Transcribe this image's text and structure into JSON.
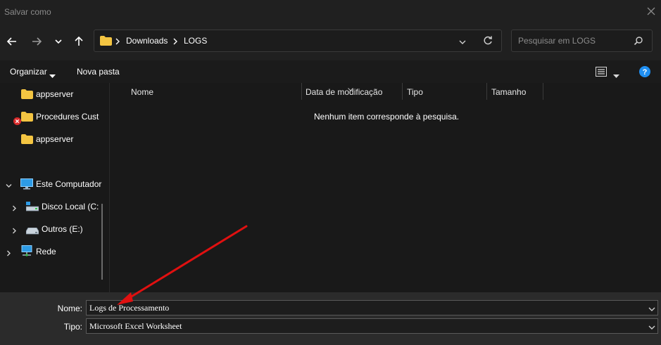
{
  "window": {
    "title": "Salvar como"
  },
  "address": {
    "crumbs": [
      "Downloads",
      "LOGS"
    ]
  },
  "search": {
    "placeholder": "Pesquisar em LOGS"
  },
  "toolbar": {
    "organize": "Organizar",
    "new_folder": "Nova pasta"
  },
  "sidebar": {
    "items": [
      {
        "label": "appserver",
        "icon": "folder-icon"
      },
      {
        "label": "Procedures Cust",
        "icon": "folder-icon"
      },
      {
        "label": "appserver",
        "icon": "folder-icon"
      },
      {
        "label": "Este Computador",
        "icon": "computer-icon"
      },
      {
        "label": "Disco Local (C:",
        "icon": "local-disk-icon"
      },
      {
        "label": "Outros (E:)",
        "icon": "drive-icon"
      },
      {
        "label": "Rede",
        "icon": "network-icon"
      }
    ]
  },
  "columns": [
    "Nome",
    "Data de modificação",
    "Tipo",
    "Tamanho"
  ],
  "empty_message": "Nenhum item corresponde à pesquisa.",
  "form": {
    "name_label": "Nome:",
    "name_value": "Logs de Processamento",
    "type_label": "Tipo:",
    "type_value": "Microsoft Excel Worksheet"
  },
  "colors": {
    "folder": "#f4c542",
    "accent": "#1f8ff2",
    "annotation": "#e01010"
  }
}
